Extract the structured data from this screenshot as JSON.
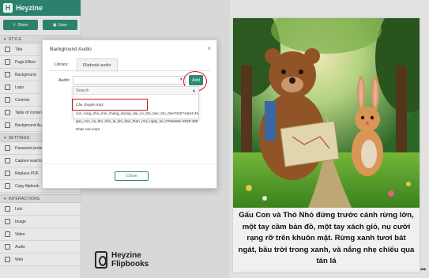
{
  "app": {
    "brand": "Heyzine"
  },
  "actions": {
    "share": "Share",
    "save": "Save"
  },
  "sections": {
    "style": "STYLE",
    "settings": "SETTINGS",
    "interactions": "INTERACTIONS"
  },
  "style_items": [
    {
      "label": "Title",
      "icon": "text-icon"
    },
    {
      "label": "Page Effect",
      "icon": "page-effect-icon"
    },
    {
      "label": "Background",
      "icon": "image-icon"
    },
    {
      "label": "Logo",
      "icon": "logo-icon"
    },
    {
      "label": "Controls",
      "icon": "controls-icon"
    },
    {
      "label": "Table of contents",
      "icon": "list-icon"
    },
    {
      "label": "Background Audio",
      "icon": "speaker-icon"
    }
  ],
  "settings_items": [
    {
      "label": "Password protect",
      "icon": "lock-icon"
    },
    {
      "label": "Capture lead form",
      "icon": "form-icon"
    },
    {
      "label": "Replace PDF",
      "icon": "refresh-icon"
    },
    {
      "label": "Copy flipbook",
      "icon": "copy-icon"
    }
  ],
  "interaction_items": [
    {
      "label": "Link",
      "icon": "link-icon"
    },
    {
      "label": "Image",
      "icon": "image-icon"
    },
    {
      "label": "Video",
      "icon": "video-icon"
    },
    {
      "label": "Audio",
      "icon": "audio-icon"
    },
    {
      "label": "Web",
      "icon": "web-icon"
    }
  ],
  "modal": {
    "title": "Background Audio",
    "tabs": [
      "Library",
      "Flipbook audio"
    ],
    "audio_label": "Audio:",
    "add_label": "Add",
    "search_label": "Search",
    "options": [
      "Câu chuyện.mp3",
      "con_rung_nhu_moi_chang_duong_dai_co_the_ban_tim_0ee7d157-5a24-46",
      "gau_con_va_tho_nho_la_doi_ban_than_moi_ngay_no_07e6e56c-4620-468",
      "Nhac nen.mp3"
    ],
    "close_label": "Close"
  },
  "footer_brand": {
    "line1": "Heyzine",
    "line2": "Flipbooks"
  },
  "preview": {
    "caption": "Gấu Con và Thỏ Nhỏ đứng trước cánh rừng lớn, một tay cầm bản đồ, một tay xách giỏ, nụ cười rạng rỡ trên khuôn mặt. Rừng xanh tươi bát ngát, bầu trời trong xanh, và nắng nhẹ chiếu qua tán lá"
  },
  "colors": {
    "accent": "#2f8a74",
    "annotation": "#d0141a"
  }
}
